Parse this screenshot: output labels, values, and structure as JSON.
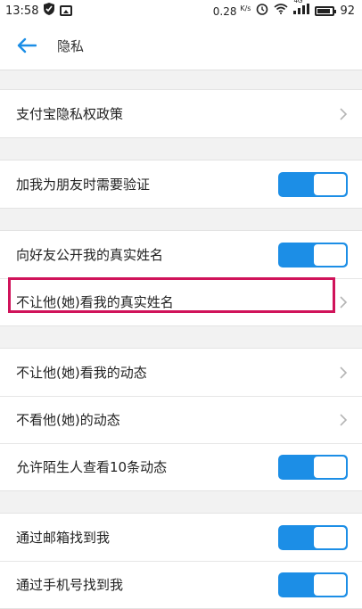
{
  "status_bar": {
    "time": "13:58",
    "net_speed_value": "0.28",
    "net_speed_unit": "K/s",
    "signal_label": "4G",
    "battery": "92"
  },
  "header": {
    "title": "隐私"
  },
  "groups": [
    {
      "rows": [
        {
          "label": "支付宝隐私权政策",
          "control": "chevron"
        }
      ]
    },
    {
      "rows": [
        {
          "label": "加我为朋友时需要验证",
          "control": "toggle",
          "on": true
        }
      ]
    },
    {
      "rows": [
        {
          "label": "向好友公开我的真实姓名",
          "control": "toggle",
          "on": true
        },
        {
          "label": "不让他(她)看我的真实姓名",
          "control": "chevron",
          "highlighted": true
        }
      ]
    },
    {
      "rows": [
        {
          "label": "不让他(她)看我的动态",
          "control": "chevron"
        },
        {
          "label": "不看他(她)的动态",
          "control": "chevron"
        },
        {
          "label": "允许陌生人查看10条动态",
          "control": "toggle",
          "on": true
        }
      ]
    },
    {
      "rows": [
        {
          "label": "通过邮箱找到我",
          "control": "toggle",
          "on": true
        },
        {
          "label": "通过手机号找到我",
          "control": "toggle",
          "on": true
        }
      ]
    }
  ],
  "colors": {
    "accent": "#1c8ee6",
    "highlight": "#d0135a"
  }
}
